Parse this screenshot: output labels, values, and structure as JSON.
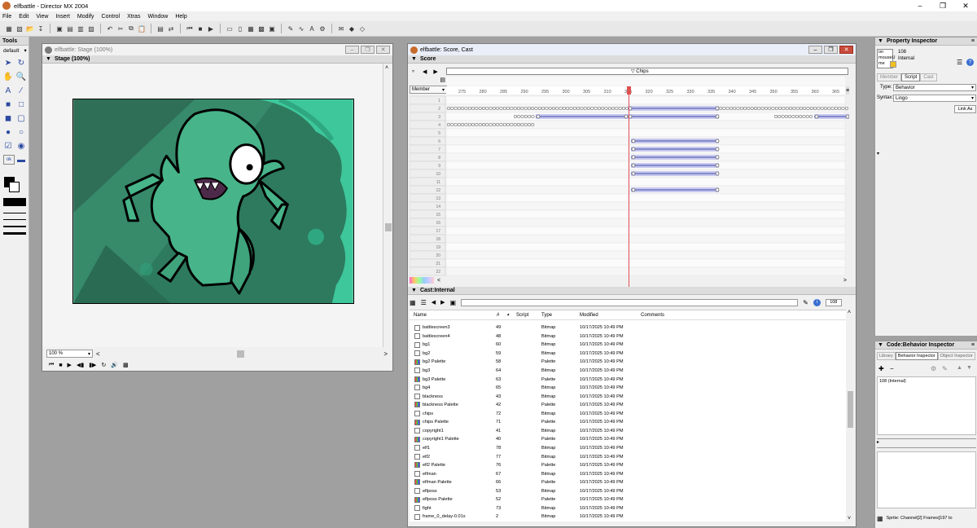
{
  "window": {
    "title": "elfbattle - Director MX 2004"
  },
  "menu": [
    "File",
    "Edit",
    "View",
    "Insert",
    "Modify",
    "Control",
    "Xtras",
    "Window",
    "Help"
  ],
  "tools": {
    "title": "Tools",
    "mode": "default"
  },
  "stage": {
    "title": "elfbattle: Stage (100%)",
    "header": "Stage (100%)",
    "zoom": "100 %"
  },
  "score": {
    "window_title": "elfbattle: Score, Cast",
    "header": "Score",
    "marker": "Chips",
    "member_label": "Member",
    "frames": [
      "275",
      "280",
      "285",
      "290",
      "295",
      "300",
      "305",
      "310",
      "315",
      "320",
      "325",
      "330",
      "335",
      "340",
      "345",
      "350",
      "355",
      "360",
      "365"
    ],
    "channels": [
      "1",
      "2",
      "3",
      "4",
      "5",
      "6",
      "7",
      "8",
      "9",
      "10",
      "11",
      "12",
      "13",
      "14",
      "15",
      "16",
      "17",
      "18",
      "19",
      "20",
      "21",
      "22"
    ]
  },
  "cast": {
    "header": "Cast:Internal",
    "count": "108",
    "columns": {
      "name": "Name",
      "num": "#",
      "script": "Script",
      "type": "Type",
      "modified": "Modified",
      "comments": "Comments"
    },
    "rows": [
      {
        "name": "battlescreen3",
        "num": "49",
        "type": "Bitmap",
        "modified": "10/17/2025 10:49 PM"
      },
      {
        "name": "battlescreen4",
        "num": "48",
        "type": "Bitmap",
        "modified": "10/17/2025 10:49 PM"
      },
      {
        "name": "bg1",
        "num": "60",
        "type": "Bitmap",
        "modified": "10/17/2025 10:49 PM"
      },
      {
        "name": "bg2",
        "num": "59",
        "type": "Bitmap",
        "modified": "10/17/2025 10:49 PM"
      },
      {
        "name": "bg2 Palette",
        "num": "58",
        "type": "Palette",
        "modified": "10/17/2025 10:49 PM"
      },
      {
        "name": "bg3",
        "num": "64",
        "type": "Bitmap",
        "modified": "10/17/2025 10:49 PM"
      },
      {
        "name": "bg3 Palette",
        "num": "63",
        "type": "Palette",
        "modified": "10/17/2025 10:49 PM"
      },
      {
        "name": "bg4",
        "num": "65",
        "type": "Bitmap",
        "modified": "10/17/2025 10:49 PM"
      },
      {
        "name": "blackness",
        "num": "43",
        "type": "Bitmap",
        "modified": "10/17/2025 10:49 PM"
      },
      {
        "name": "blackness Palette",
        "num": "42",
        "type": "Palette",
        "modified": "10/17/2025 10:49 PM"
      },
      {
        "name": "chips",
        "num": "72",
        "type": "Bitmap",
        "modified": "10/17/2025 10:49 PM"
      },
      {
        "name": "chips Palette",
        "num": "71",
        "type": "Palette",
        "modified": "10/17/2025 10:49 PM"
      },
      {
        "name": "copyright1",
        "num": "41",
        "type": "Bitmap",
        "modified": "10/17/2025 10:49 PM"
      },
      {
        "name": "copyright1 Palette",
        "num": "40",
        "type": "Palette",
        "modified": "10/17/2025 10:49 PM"
      },
      {
        "name": "elf1",
        "num": "78",
        "type": "Bitmap",
        "modified": "10/17/2025 10:49 PM"
      },
      {
        "name": "elf2",
        "num": "77",
        "type": "Bitmap",
        "modified": "10/17/2025 10:49 PM"
      },
      {
        "name": "elf2 Palette",
        "num": "76",
        "type": "Palette",
        "modified": "10/17/2025 10:49 PM"
      },
      {
        "name": "elfman",
        "num": "67",
        "type": "Bitmap",
        "modified": "10/17/2025 10:49 PM"
      },
      {
        "name": "elfman Palette",
        "num": "66",
        "type": "Palette",
        "modified": "10/17/2025 10:49 PM"
      },
      {
        "name": "elfposs",
        "num": "53",
        "type": "Bitmap",
        "modified": "10/17/2025 10:49 PM"
      },
      {
        "name": "elfposs Palette",
        "num": "52",
        "type": "Palette",
        "modified": "10/17/2025 10:49 PM"
      },
      {
        "name": "fight",
        "num": "73",
        "type": "Bitmap",
        "modified": "10/17/2025 10:49 PM"
      },
      {
        "name": "frame_0_delay-0.01s",
        "num": "2",
        "type": "Bitmap",
        "modified": "10/17/2025 10:49 PM"
      }
    ]
  },
  "property_inspector": {
    "title": "Property Inspector",
    "handler_lines": [
      "on",
      "mouseU",
      "me"
    ],
    "member_num": "108",
    "member_type": "Internal",
    "tabs": [
      "Member",
      "Script",
      "Cast"
    ],
    "type_label": "Type:",
    "type_value": "Behavior",
    "syntax_label": "Syntax:",
    "syntax_value": "Lingo",
    "link_button": "Link As"
  },
  "code_inspector": {
    "title": "Code:Behavior Inspector",
    "tabs": [
      "Library",
      "Behavior Inspector",
      "Object Inspector"
    ],
    "entry": "108 (Internal)",
    "status": "Sprite: Channel[2] Frames[197 to"
  }
}
